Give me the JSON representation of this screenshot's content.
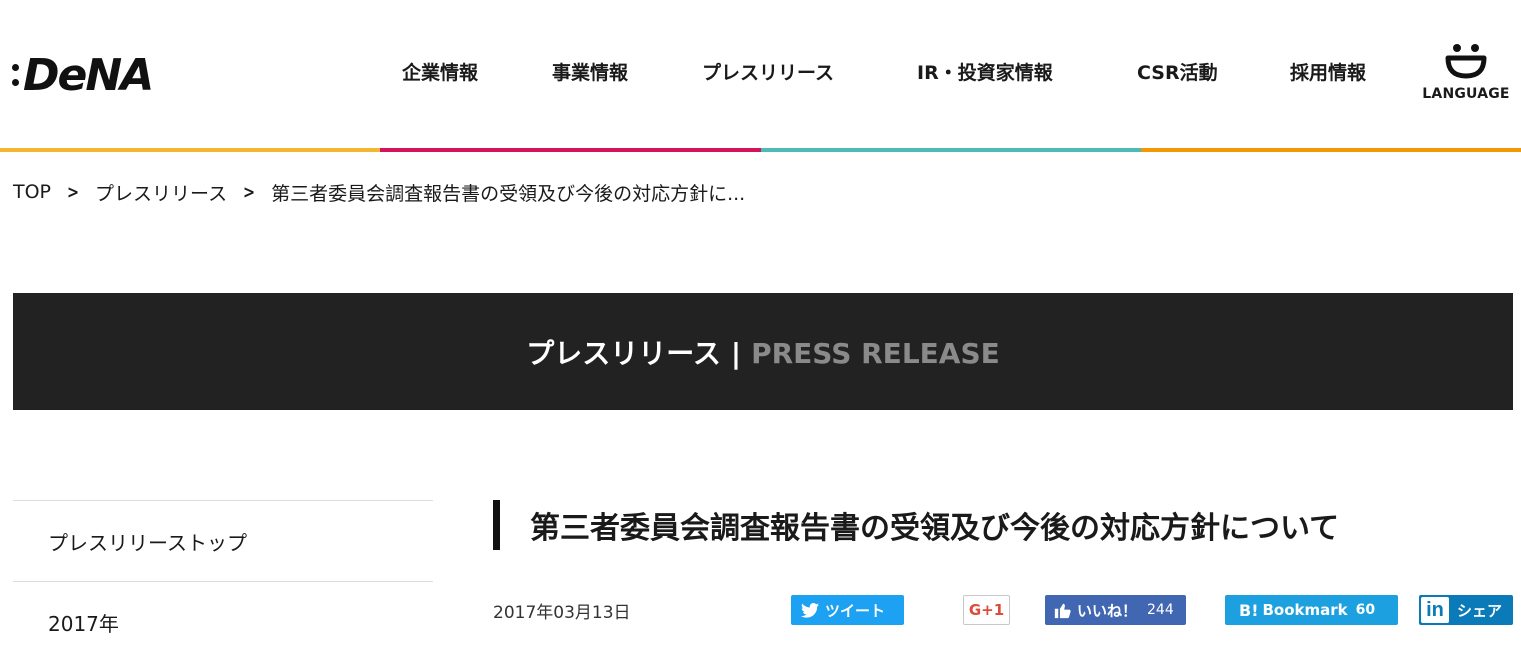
{
  "brand": {
    "logo_text": "DeNA"
  },
  "nav": {
    "items": [
      {
        "label": "企業情報"
      },
      {
        "label": "事業情報"
      },
      {
        "label": "プレスリリース"
      },
      {
        "label": "IR・投資家情報"
      },
      {
        "label": "CSR活動"
      },
      {
        "label": "採用情報"
      }
    ],
    "language_label": "LANGUAGE",
    "language_icon": "smile-globe-icon"
  },
  "colorbar": [
    "#f5b731",
    "#d4145a",
    "#4dbbb5",
    "#f39800"
  ],
  "breadcrumb": {
    "items": [
      "TOP",
      "プレスリリース",
      "第三者委員会調査報告書の受領及び今後の対応方針に..."
    ],
    "separator": ">"
  },
  "banner": {
    "title_ja": "プレスリリース",
    "divider": "|",
    "title_en": "PRESS RELEASE"
  },
  "sidebar": {
    "items": [
      "プレスリリーストップ",
      "2017年"
    ]
  },
  "article": {
    "title": "第三者委員会調査報告書の受領及び今後の対応方針について",
    "date": "2017年03月13日"
  },
  "share": {
    "twitter": {
      "label": "ツイート",
      "icon": "twitter-bird-icon",
      "color": "#1da1f2"
    },
    "google_plus": {
      "label": "G+1",
      "color": "#dd4b39"
    },
    "facebook": {
      "label": "いいね！",
      "count": "244",
      "icon": "thumbs-up-icon",
      "color": "#4267b2"
    },
    "hatena": {
      "mark": "B!",
      "label": "Bookmark",
      "count": "60",
      "color": "#1da0e0"
    },
    "linkedin": {
      "mark": "in",
      "label": "シェア",
      "color": "#0a7ab8"
    }
  }
}
